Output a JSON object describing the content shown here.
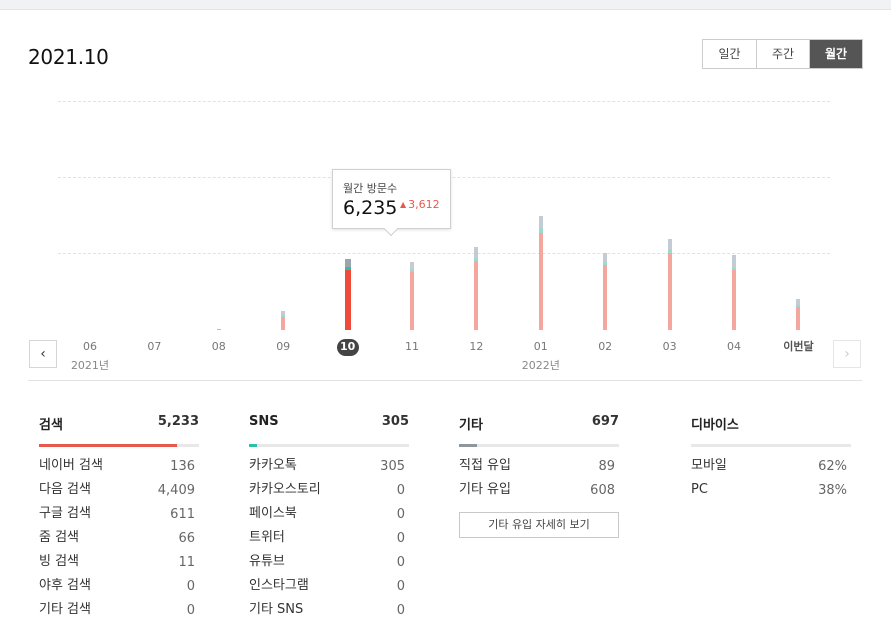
{
  "header": {
    "title": "2021.10"
  },
  "period_tabs": [
    "일간",
    "주간",
    "월간"
  ],
  "active_tab_index": 2,
  "chart_data": {
    "type": "bar",
    "categories": [
      "06",
      "07",
      "08",
      "09",
      "10",
      "11",
      "12",
      "01",
      "02",
      "03",
      "04",
      "이번달"
    ],
    "year_labels": {
      "06": "2021년",
      "01": "2022년"
    },
    "selected_category": "10",
    "series": [
      {
        "name": "검색",
        "values": [
          0,
          0,
          10,
          1120,
          5233,
          5080,
          6070,
          8490,
          5740,
          6760,
          5300,
          2060
        ],
        "color": "#f4a79f",
        "selected_color": "#ef4b3b"
      },
      {
        "name": "SNS",
        "values": [
          0,
          0,
          0,
          170,
          305,
          230,
          250,
          490,
          240,
          360,
          140,
          110
        ],
        "color": "#9ed8cf",
        "selected_color": "#2fbfa8"
      },
      {
        "name": "기타",
        "values": [
          0,
          0,
          0,
          350,
          697,
          650,
          990,
          1030,
          800,
          900,
          1130,
          570
        ],
        "color": "#c3ccd2",
        "selected_color": "#9aa5ad"
      }
    ],
    "ylim": [
      0,
      20000
    ],
    "grid": true
  },
  "tooltip": {
    "label": "월간 방문수",
    "value": "6,235",
    "diff": "3,612",
    "diff_arrow": "▲"
  },
  "stats": {
    "search": {
      "title": "검색",
      "total": "5,233",
      "share": 0.86,
      "color": "#e8584f",
      "rows": [
        {
          "label": "네이버 검색",
          "value": "136"
        },
        {
          "label": "다음 검색",
          "value": "4,409"
        },
        {
          "label": "구글 검색",
          "value": "611"
        },
        {
          "label": "줌 검색",
          "value": "66"
        },
        {
          "label": "빙 검색",
          "value": "11"
        },
        {
          "label": "야후 검색",
          "value": "0"
        },
        {
          "label": "기타 검색",
          "value": "0"
        }
      ]
    },
    "sns": {
      "title": "SNS",
      "total": "305",
      "share": 0.05,
      "color": "#2fbfa8",
      "rows": [
        {
          "label": "카카오톡",
          "value": "305"
        },
        {
          "label": "카카오스토리",
          "value": "0"
        },
        {
          "label": "페이스북",
          "value": "0"
        },
        {
          "label": "트위터",
          "value": "0"
        },
        {
          "label": "유튜브",
          "value": "0"
        },
        {
          "label": "인스타그램",
          "value": "0"
        },
        {
          "label": "기타 SNS",
          "value": "0"
        }
      ]
    },
    "etc": {
      "title": "기타",
      "total": "697",
      "share": 0.11,
      "color": "#8e979d",
      "rows": [
        {
          "label": "직접 유입",
          "value": "89"
        },
        {
          "label": "기타 유입",
          "value": "608"
        }
      ],
      "more_label": "기타 유입 자세히 보기"
    },
    "device": {
      "title": "디바이스",
      "rows": [
        {
          "label": "모바일",
          "value": "62%"
        },
        {
          "label": "PC",
          "value": "38%"
        }
      ]
    }
  },
  "nav": {
    "prev_icon": "‹",
    "next_icon": "›"
  }
}
